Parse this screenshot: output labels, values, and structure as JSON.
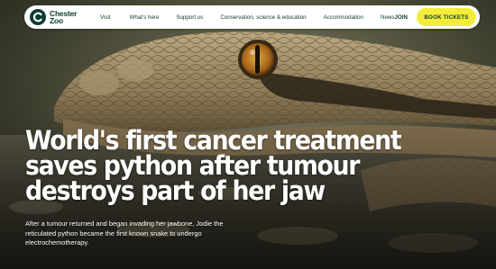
{
  "brand": {
    "name_line1": "Chester",
    "name_line2": "Zoo",
    "colors": {
      "primary": "#0b3d34",
      "accent": "#f4ec3b"
    }
  },
  "nav": {
    "links": [
      "Visit",
      "What's here",
      "Support us",
      "Conservation, science & education",
      "Accommodation",
      "News"
    ],
    "join_label": "JOIN",
    "cta_label": "BOOK TICKETS"
  },
  "hero": {
    "image_subject": "python-close-up",
    "headline": "World's first cancer treatment saves python after tumour destroys part of her jaw",
    "summary": "After a tumour returned and began invading her jawbone, Jodie the reticulated python became the first known snake to undergo electrochemotherapy."
  }
}
